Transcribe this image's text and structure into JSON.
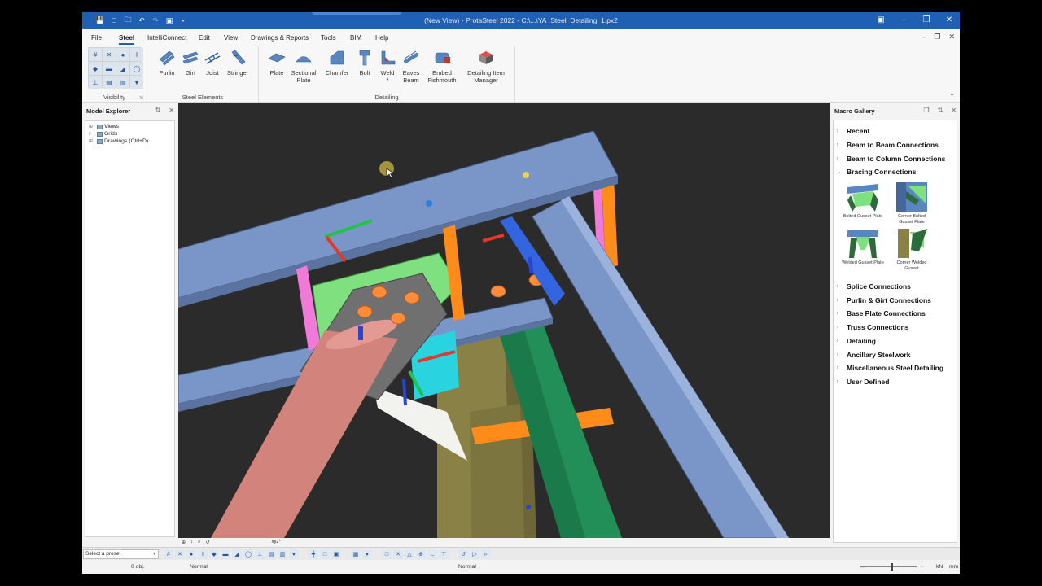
{
  "window": {
    "title": "(New View) - ProtaSteel 2022 - C:\\...\\YA_Steel_Detailing_1.px2",
    "qat_icons": [
      "save-icon",
      "new-icon",
      "open-icon",
      "undo-icon",
      "redo-icon",
      "fit-view-icon",
      "customize-icon"
    ],
    "controls": [
      "help-icon",
      "minimize-icon",
      "maximize-icon",
      "close-icon"
    ]
  },
  "menu": {
    "items": [
      "File",
      "Steel",
      "IntelliConnect",
      "Edit",
      "View",
      "Drawings & Reports",
      "Tools",
      "BIM",
      "Help"
    ],
    "active": "Steel"
  },
  "ribbon": {
    "groups": {
      "visibility": "Visibility",
      "steel_elements": "Steel Elements",
      "detailing": "Detailing"
    },
    "steel_elements": [
      {
        "label": "Purlin",
        "icon": "purlin-icon"
      },
      {
        "label": "Girt",
        "icon": "girt-icon"
      },
      {
        "label": "Joist",
        "icon": "joist-icon"
      },
      {
        "label": "Stringer",
        "icon": "stringer-icon"
      }
    ],
    "detailing": [
      {
        "label": "Plate",
        "icon": "plate-icon"
      },
      {
        "label": "Sectional\nPlate",
        "icon": "sectional-plate-icon"
      },
      {
        "label": "Chamfer",
        "icon": "chamfer-icon"
      },
      {
        "label": "Bolt",
        "icon": "bolt-icon"
      },
      {
        "label": "Weld",
        "icon": "weld-icon"
      },
      {
        "label": "Eaves\nBeam",
        "icon": "eaves-beam-icon"
      },
      {
        "label": "Embed\nFishmouth",
        "icon": "embed-fishmouth-icon"
      },
      {
        "label": "Detailing Item\nManager",
        "icon": "detailing-item-manager-icon"
      }
    ]
  },
  "model_explorer": {
    "title": "Model Explorer",
    "nodes": [
      "Views",
      "Grids",
      "Drawings (Ctrl+D)"
    ]
  },
  "macro_gallery": {
    "title": "Macro Gallery",
    "categories_top": [
      "Recent",
      "Beam to Beam Connections",
      "Beam to Column Connections",
      "Bracing Connections"
    ],
    "expanded": "Bracing Connections",
    "thumbnails": [
      "Bolted Gusset Plate",
      "Corner Bolted\nGusset Plate",
      "Welded Gusset Plate",
      "Corner Welded\nGusset"
    ],
    "categories_bottom": [
      "Splice Connections",
      "Purlin & Girt Connections",
      "Base Plate Connections",
      "Truss Connections",
      "Detailing",
      "Ancillary Steelwork",
      "Miscellaneous Steel Detailing",
      "User Defined"
    ]
  },
  "bottom": {
    "preset_placeholder": "Select a preset",
    "view_toolbar_text": "xyz*",
    "obj_count": "0 obj.",
    "mode_left": "Normal",
    "mode_right": "Normal",
    "units": [
      "kN",
      "mm"
    ]
  },
  "colors": {
    "titlebar": "#1f5fb4",
    "viewport_bg": "#2b2b2b",
    "beam": "#7a96c8",
    "plate_green": "#7ee07e",
    "gusset_grey": "#707070",
    "pipe": "#d2837c",
    "column_olive": "#8a8147",
    "brace_green": "#1a7a4a",
    "stiffener_orange": "#ff8c1a",
    "stiffener_pink": "#f07ad8",
    "bolt_orange": "#ff8c3a"
  }
}
